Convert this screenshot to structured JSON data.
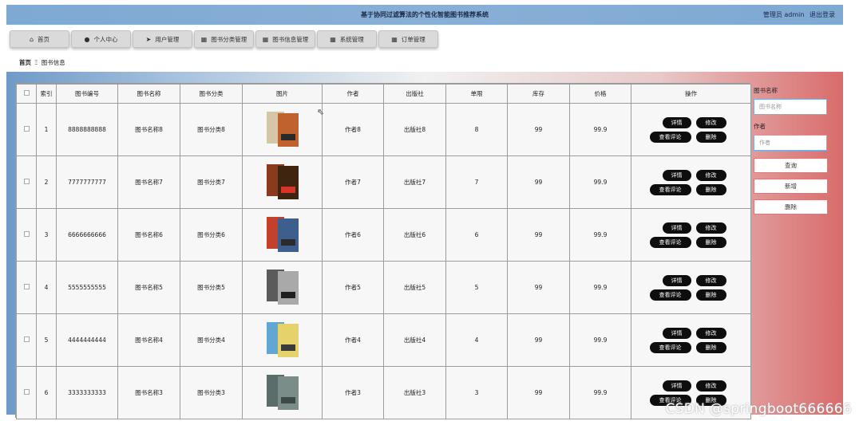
{
  "header": {
    "title": "基于协同过滤算法的个性化智能图书推荐系统",
    "user_label": "管理员 admin",
    "logout": "退出登录"
  },
  "nav": [
    {
      "label": "首页",
      "icon": "home-icon"
    },
    {
      "label": "个人中心",
      "icon": "user-icon"
    },
    {
      "label": "用户管理",
      "icon": "send-icon"
    },
    {
      "label": "图书分类管理",
      "icon": "grid-icon"
    },
    {
      "label": "图书信息管理",
      "icon": "grid-icon"
    },
    {
      "label": "系统管理",
      "icon": "grid-icon"
    },
    {
      "label": "订单管理",
      "icon": "grid-icon"
    }
  ],
  "breadcrumb": {
    "root": "首页",
    "current": "图书信息"
  },
  "table": {
    "columns": [
      "索引",
      "图书编号",
      "图书名称",
      "图书分类",
      "图片",
      "作者",
      "出版社",
      "单限",
      "库存",
      "价格",
      "操作"
    ],
    "rows": [
      {
        "index": "1",
        "code": "8888888888",
        "name": "图书名称8",
        "category": "图书分类8",
        "author": "作者8",
        "publisher": "出版社8",
        "limit": "8",
        "stock": "99",
        "price": "99.9"
      },
      {
        "index": "2",
        "code": "7777777777",
        "name": "图书名称7",
        "category": "图书分类7",
        "author": "作者7",
        "publisher": "出版社7",
        "limit": "7",
        "stock": "99",
        "price": "99.9"
      },
      {
        "index": "3",
        "code": "6666666666",
        "name": "图书名称6",
        "category": "图书分类6",
        "author": "作者6",
        "publisher": "出版社6",
        "limit": "6",
        "stock": "99",
        "price": "99.9"
      },
      {
        "index": "4",
        "code": "5555555555",
        "name": "图书名称5",
        "category": "图书分类5",
        "author": "作者5",
        "publisher": "出版社5",
        "limit": "5",
        "stock": "99",
        "price": "99.9"
      },
      {
        "index": "5",
        "code": "4444444444",
        "name": "图书名称4",
        "category": "图书分类4",
        "author": "作者4",
        "publisher": "出版社4",
        "limit": "4",
        "stock": "99",
        "price": "99.9"
      },
      {
        "index": "6",
        "code": "3333333333",
        "name": "图书名称3",
        "category": "图书分类3",
        "author": "作者3",
        "publisher": "出版社3",
        "limit": "3",
        "stock": "99",
        "price": "99.9"
      }
    ],
    "actions": {
      "detail": "详情",
      "edit": "修改",
      "reviews": "查看评论",
      "delete": "删除"
    }
  },
  "search": {
    "name_label": "图书名称",
    "name_placeholder": "图书名称",
    "author_label": "作者",
    "author_placeholder": "作者",
    "query": "查询",
    "add": "新增",
    "delete": "删除"
  },
  "watermark": "CSDN @springboot666666"
}
